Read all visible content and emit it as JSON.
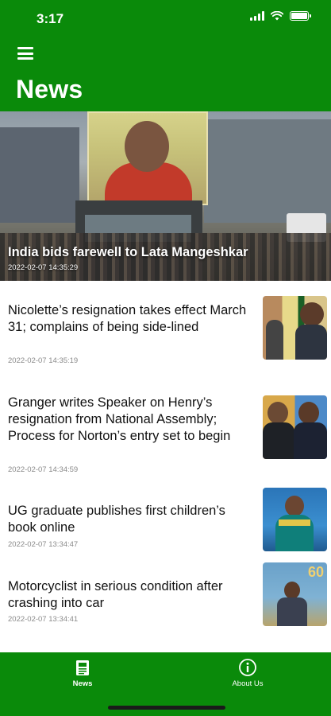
{
  "status_bar": {
    "time": "3:17"
  },
  "header": {
    "title": "News",
    "menu_icon": "hamburger-menu-icon"
  },
  "featured": {
    "title": "India bids farewell to Lata Mangeshkar",
    "date": "2022-02-07 14:35:29"
  },
  "articles": [
    {
      "title": "Nicolette’s resignation takes effect March 31; complains of being side-lined",
      "date": "2022-02-07 14:35:19"
    },
    {
      "title": "Granger writes Speaker on Henry’s resignation from National Assembly; Process for Norton’s entry set to begin",
      "date": "2022-02-07 14:34:59"
    },
    {
      "title": "UG graduate publishes first children’s book online",
      "date": "2022-02-07 13:34:47"
    },
    {
      "title": "Motorcyclist in serious condition after crashing into car",
      "date": "2022-02-07 13:34:41"
    }
  ],
  "thumbnail_text": {
    "anniversary_number": "60"
  },
  "tabbar": {
    "news_label": "News",
    "about_label": "About Us",
    "news_icon": "newspaper-icon",
    "about_icon": "info-circle-icon",
    "active": "News"
  },
  "colors": {
    "brand_green": "#0a8a0a",
    "date_gray": "#8a8a8a"
  }
}
